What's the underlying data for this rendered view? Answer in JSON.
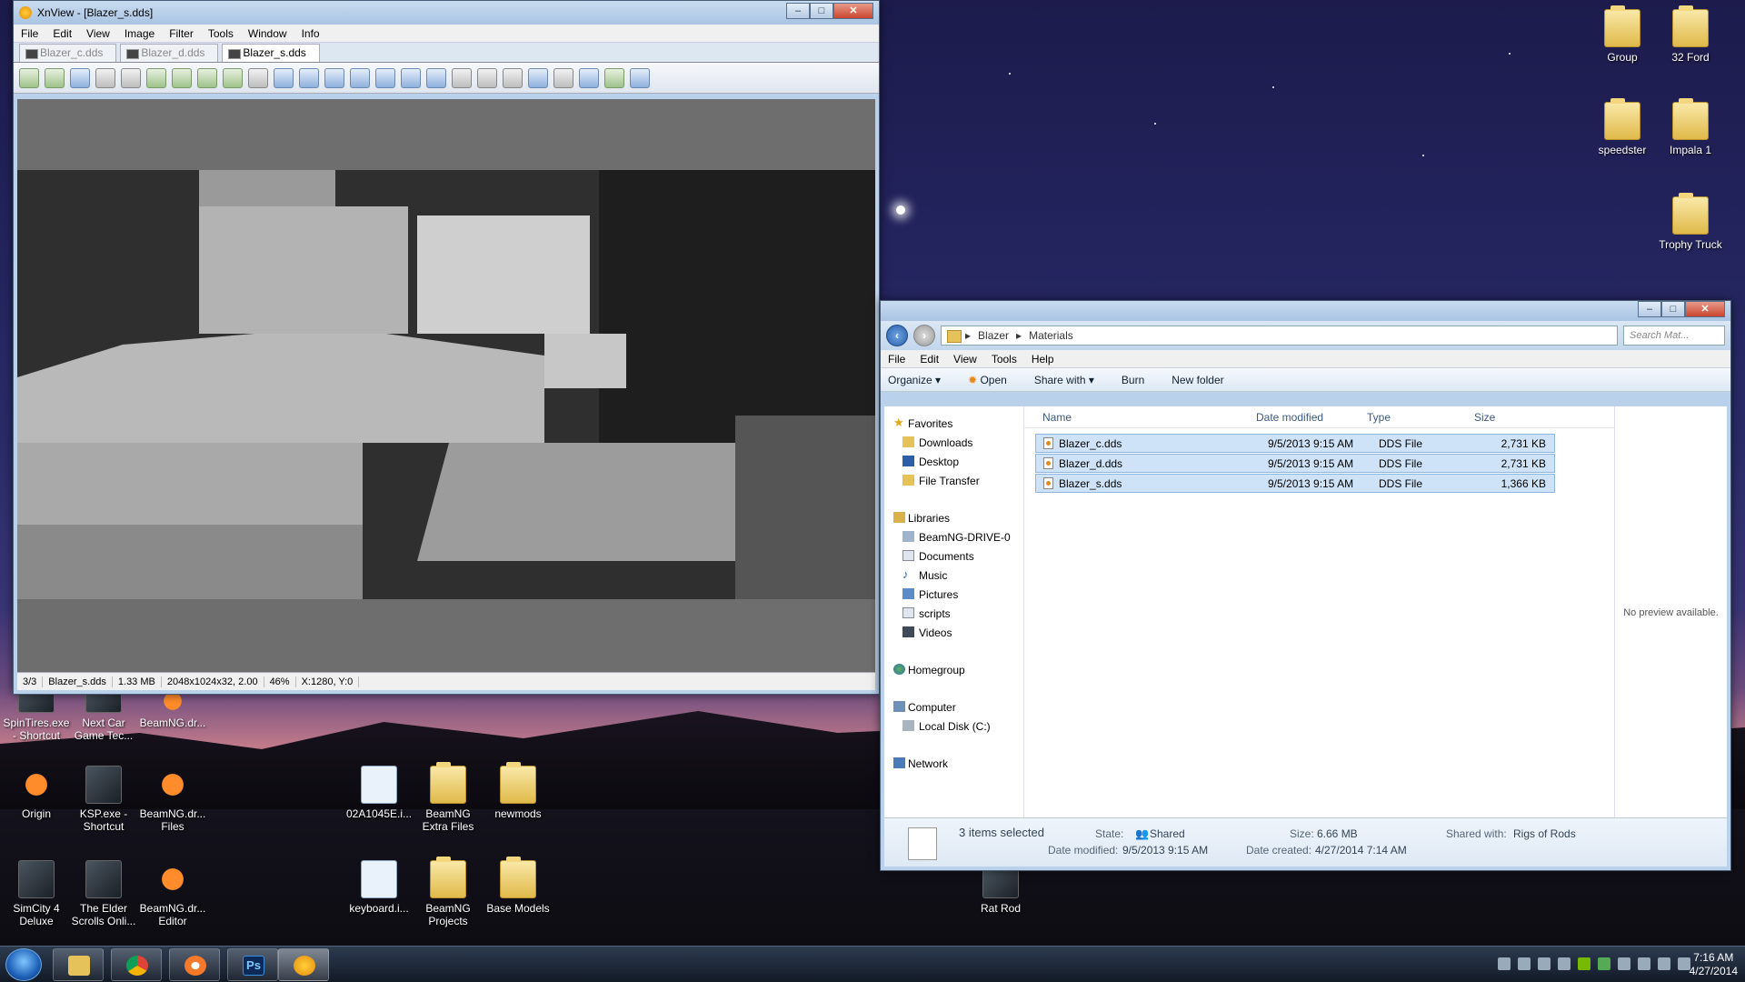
{
  "xnview": {
    "title": "XnView - [Blazer_s.dds]",
    "menu": [
      "File",
      "Edit",
      "View",
      "Image",
      "Filter",
      "Tools",
      "Window",
      "Info"
    ],
    "tabs": [
      "Blazer_c.dds",
      "Blazer_d.dds",
      "Blazer_s.dds"
    ],
    "active_tab": 2,
    "status": {
      "index": "3/3",
      "file": "Blazer_s.dds",
      "size": "1.33 MB",
      "dims": "2048x1024x32, 2.00",
      "zoom": "46%",
      "coords": "X:1280, Y:0"
    }
  },
  "explorer": {
    "breadcrumb": [
      "Blazer",
      "Materials"
    ],
    "search_placeholder": "Search Mat...",
    "menu": [
      "File",
      "Edit",
      "View",
      "Tools",
      "Help"
    ],
    "commands": {
      "organize": "Organize",
      "open": "Open",
      "share": "Share with",
      "burn": "Burn",
      "new_folder": "New folder"
    },
    "nav": {
      "favorites": "Favorites",
      "fav_items": [
        "Downloads",
        "Desktop",
        "File Transfer"
      ],
      "libraries": "Libraries",
      "lib_items": [
        "BeamNG-DRIVE-0",
        "Documents",
        "Music",
        "Pictures",
        "scripts",
        "Videos"
      ],
      "homegroup": "Homegroup",
      "computer": "Computer",
      "computer_items": [
        "Local Disk (C:)"
      ],
      "network": "Network"
    },
    "columns": {
      "name": "Name",
      "date": "Date modified",
      "type": "Type",
      "size": "Size"
    },
    "files": [
      {
        "name": "Blazer_c.dds",
        "date": "9/5/2013 9:15 AM",
        "type": "DDS File",
        "size": "2,731 KB"
      },
      {
        "name": "Blazer_d.dds",
        "date": "9/5/2013 9:15 AM",
        "type": "DDS File",
        "size": "2,731 KB"
      },
      {
        "name": "Blazer_s.dds",
        "date": "9/5/2013 9:15 AM",
        "type": "DDS File",
        "size": "1,366 KB"
      }
    ],
    "preview": "No preview available.",
    "details": {
      "selected": "3 items selected",
      "state_label": "State:",
      "state": "Shared",
      "size_label": "Size:",
      "size": "6.66 MB",
      "shared_label": "Shared with:",
      "shared": "Rigs of Rods",
      "modified_label": "Date modified:",
      "modified": "9/5/2013 9:15 AM",
      "created_label": "Date created:",
      "created": "4/27/2014 7:14 AM"
    }
  },
  "desktop_icons": {
    "group": "Group",
    "ford": "32 Ford",
    "speedster": "speedster",
    "impala": "Impala 1",
    "trophy": "Trophy Truck",
    "spintires": "SpinTires.exe - Shortcut",
    "nextcar": "Next Car Game Tec...",
    "beamng1": "BeamNG.dr...",
    "origin": "Origin",
    "ksp": "KSP.exe - Shortcut",
    "beamngfiles": "BeamNG.dr... Files",
    "doc02": "02A1045E.i...",
    "beamextra": "BeamNG Extra Files",
    "newmods": "newmods",
    "simcity": "SimCity 4 Deluxe",
    "elder": "The Elder Scrolls Onli...",
    "beameditor": "BeamNG.dr... Editor",
    "keyboard": "keyboard.i...",
    "beamproj": "BeamNG Projects",
    "basemodels": "Base Models",
    "ratrod": "Rat Rod"
  },
  "taskbar": {
    "time": "7:16 AM",
    "date": "4/27/2014"
  }
}
